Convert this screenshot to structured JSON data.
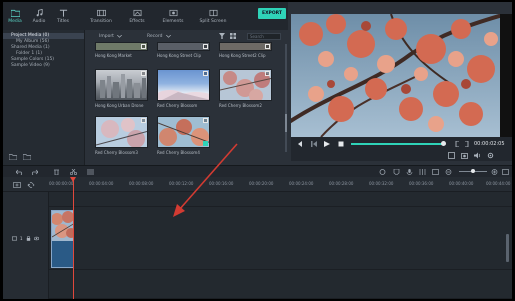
{
  "toptabs": [
    {
      "label": "Media",
      "icon": "folder-icon"
    },
    {
      "label": "Audio",
      "icon": "music-note-icon"
    },
    {
      "label": "Titles",
      "icon": "text-t-icon"
    },
    {
      "label": "Transition",
      "icon": "transition-icon"
    },
    {
      "label": "Effects",
      "icon": "effects-icon"
    },
    {
      "label": "Elements",
      "icon": "elements-icon"
    },
    {
      "label": "Split Screen",
      "icon": "split-screen-icon"
    }
  ],
  "export_label": "EXPORT",
  "sidebar": {
    "items": [
      {
        "label": "Project Media (0)",
        "indent": 1,
        "selected": true
      },
      {
        "label": "My Album (56)",
        "indent": 2
      },
      {
        "label": "Shared Media (1)",
        "indent": 1
      },
      {
        "label": "Folder 1 (1)",
        "indent": 2
      },
      {
        "label": "Sample Colors (15)",
        "indent": 1
      },
      {
        "label": "Sample Video (9)",
        "indent": 1
      }
    ]
  },
  "media": {
    "import_label": "Import",
    "record_label": "Record",
    "search_placeholder": "Search",
    "items": [
      {
        "caption": "Hong Kong Market",
        "scene": "market"
      },
      {
        "caption": "Hong Kong Street Clip",
        "scene": "street"
      },
      {
        "caption": "Hong Kong Street2 Clip",
        "scene": "street2"
      },
      {
        "caption": "Hong Kong Urban Drone",
        "scene": "drone"
      },
      {
        "caption": "Red Cherry Blossom",
        "scene": "sky"
      },
      {
        "caption": "Red Cherry Blossom2",
        "scene": "cherry"
      },
      {
        "caption": "Red Cherry Blossom3",
        "scene": "cherry2"
      },
      {
        "caption": "Red Cherry Blossom4",
        "scene": "cherry3",
        "checked": true
      }
    ]
  },
  "preview": {
    "timecode": "00:00:02:05",
    "progress": 0.97
  },
  "timeline": {
    "ruler_labels": [
      "00:00:00:00",
      "00:00:04:00",
      "00:00:08:00",
      "00:00:12:00",
      "00:00:16:00",
      "00:00:20:00",
      "00:00:24:00",
      "00:00:28:00",
      "00:00:32:00",
      "00:00:36:00",
      "00:00:40:00",
      "00:00:44:00"
    ],
    "track_label": "1"
  },
  "colors": {
    "accent": "#2fd3b8",
    "playhead": "#e0483c",
    "annotation_arrow": "#d23b32"
  }
}
